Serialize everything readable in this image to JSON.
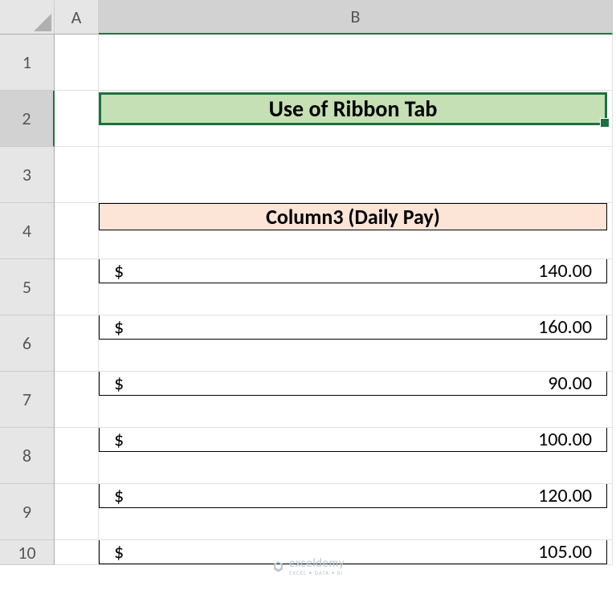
{
  "columns": {
    "A": "A",
    "B": "B"
  },
  "rows": [
    "1",
    "2",
    "3",
    "4",
    "5",
    "6",
    "7",
    "8",
    "9",
    "10"
  ],
  "title": "Use of Ribbon Tab",
  "table_header": "Column3 (Daily Pay)",
  "currency_symbol": "$",
  "chart_data": {
    "type": "table",
    "title": "Column3 (Daily Pay)",
    "columns": [
      "Daily Pay"
    ],
    "rows": [
      {
        "value": "140.00"
      },
      {
        "value": "160.00"
      },
      {
        "value": "90.00"
      },
      {
        "value": "100.00"
      },
      {
        "value": "120.00"
      },
      {
        "value": "105.00"
      }
    ]
  },
  "watermark": {
    "text": "exceldemy",
    "subtext": "EXCEL • DATA • BI"
  }
}
